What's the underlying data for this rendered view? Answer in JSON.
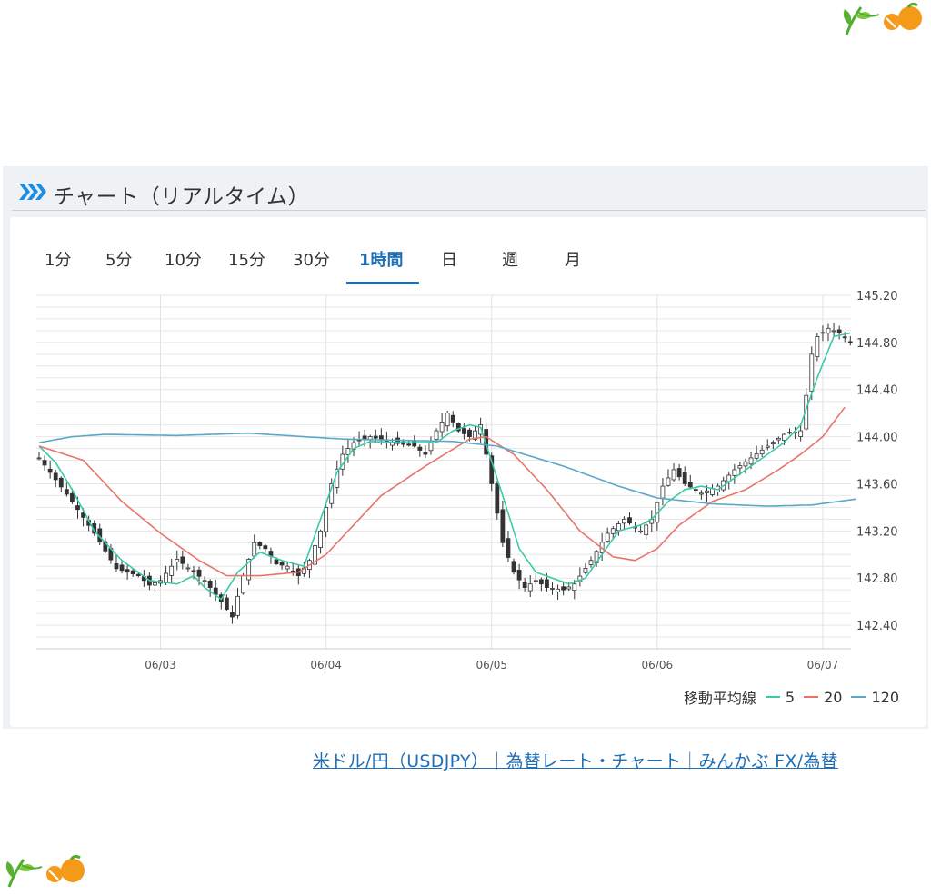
{
  "panel": {
    "title": "チャート（リアルタイム）",
    "tabs": [
      {
        "label": "1分",
        "active": false
      },
      {
        "label": "5分",
        "active": false
      },
      {
        "label": "10分",
        "active": false
      },
      {
        "label": "15分",
        "active": false
      },
      {
        "label": "30分",
        "active": false
      },
      {
        "label": "1時間",
        "active": true
      },
      {
        "label": "日",
        "active": false
      },
      {
        "label": "週",
        "active": false
      },
      {
        "label": "月",
        "active": false
      }
    ],
    "legend": {
      "label": "移動平均線",
      "items": [
        {
          "name": "5",
          "color": "#3cc9a8"
        },
        {
          "name": "20",
          "color": "#e8756b"
        },
        {
          "name": "120",
          "color": "#5aa8c8"
        }
      ]
    }
  },
  "footer_link": "米ドル/円（USDJPY）｜為替レート・チャート｜みんかぶ FX/為替",
  "colors": {
    "accent": "#1e6fb5",
    "candle_up": "#ffffff",
    "candle_down": "#333333"
  },
  "icons": [
    "chevron-right-icon",
    "leaf-orange-icon"
  ],
  "chart_data": {
    "type": "candlestick",
    "x_tick_labels": [
      "06/03",
      "06/04",
      "06/05",
      "06/06",
      "06/07"
    ],
    "y_tick_labels": [
      "142.40",
      "142.80",
      "143.20",
      "143.60",
      "144.00",
      "144.40",
      "144.80",
      "145.20"
    ],
    "ylim": [
      142.2,
      145.2
    ],
    "grid": true,
    "legend_position": "bottom-right",
    "moving_averages": [
      {
        "name": "5",
        "anchors": [
          [
            0,
            143.92
          ],
          [
            3,
            143.78
          ],
          [
            6,
            143.55
          ],
          [
            10,
            143.2
          ],
          [
            15,
            142.95
          ],
          [
            20,
            142.78
          ],
          [
            25,
            142.75
          ],
          [
            28,
            142.82
          ],
          [
            30,
            142.72
          ],
          [
            33,
            142.62
          ],
          [
            36,
            142.85
          ],
          [
            40,
            143.02
          ],
          [
            44,
            142.95
          ],
          [
            48,
            142.9
          ],
          [
            51,
            143.3
          ],
          [
            54,
            143.7
          ],
          [
            57,
            143.9
          ],
          [
            60,
            143.96
          ],
          [
            66,
            143.95
          ],
          [
            72,
            143.95
          ],
          [
            75,
            144.05
          ],
          [
            78,
            144.1
          ],
          [
            80,
            144.08
          ],
          [
            84,
            143.5
          ],
          [
            87,
            143.05
          ],
          [
            90,
            142.85
          ],
          [
            93,
            142.8
          ],
          [
            96,
            142.75
          ],
          [
            99,
            142.8
          ],
          [
            102,
            143.0
          ],
          [
            105,
            143.2
          ],
          [
            109,
            143.25
          ],
          [
            111,
            143.3
          ],
          [
            114,
            143.45
          ],
          [
            117,
            143.55
          ],
          [
            120,
            143.58
          ],
          [
            123,
            143.55
          ],
          [
            126,
            143.65
          ],
          [
            129,
            143.75
          ],
          [
            132,
            143.85
          ],
          [
            135,
            143.95
          ],
          [
            138,
            144.1
          ],
          [
            141,
            144.5
          ],
          [
            144,
            144.85
          ],
          [
            147,
            144.88
          ]
        ]
      },
      {
        "name": "20",
        "anchors": [
          [
            0,
            143.92
          ],
          [
            8,
            143.8
          ],
          [
            15,
            143.45
          ],
          [
            22,
            143.18
          ],
          [
            29,
            142.95
          ],
          [
            34,
            142.82
          ],
          [
            40,
            142.82
          ],
          [
            47,
            142.85
          ],
          [
            52,
            143.0
          ],
          [
            57,
            143.25
          ],
          [
            62,
            143.5
          ],
          [
            70,
            143.75
          ],
          [
            78,
            143.98
          ],
          [
            81,
            144.0
          ],
          [
            86,
            143.85
          ],
          [
            92,
            143.55
          ],
          [
            98,
            143.2
          ],
          [
            104,
            142.98
          ],
          [
            108,
            142.95
          ],
          [
            112,
            143.05
          ],
          [
            116,
            143.25
          ],
          [
            122,
            143.45
          ],
          [
            128,
            143.55
          ],
          [
            134,
            143.72
          ],
          [
            138,
            143.85
          ],
          [
            142,
            144.0
          ],
          [
            146,
            144.25
          ]
        ]
      },
      {
        "name": "120",
        "anchors": [
          [
            0,
            143.95
          ],
          [
            6,
            144.0
          ],
          [
            12,
            144.02
          ],
          [
            25,
            144.01
          ],
          [
            38,
            144.03
          ],
          [
            48,
            144.0
          ],
          [
            55,
            143.98
          ],
          [
            65,
            143.97
          ],
          [
            75,
            143.96
          ],
          [
            83,
            143.92
          ],
          [
            95,
            143.75
          ],
          [
            105,
            143.58
          ],
          [
            112,
            143.48
          ],
          [
            122,
            143.43
          ],
          [
            132,
            143.41
          ],
          [
            140,
            143.42
          ],
          [
            148,
            143.47
          ]
        ]
      }
    ],
    "price_anchors": [
      [
        0,
        143.82
      ],
      [
        6,
        143.45
      ],
      [
        10,
        143.18
      ],
      [
        14,
        142.88
      ],
      [
        18,
        142.82
      ],
      [
        20,
        142.74
      ],
      [
        22,
        142.78
      ],
      [
        25,
        142.96
      ],
      [
        28,
        142.85
      ],
      [
        30,
        142.78
      ],
      [
        33,
        142.6
      ],
      [
        35,
        142.47
      ],
      [
        37,
        142.82
      ],
      [
        39,
        143.1
      ],
      [
        41,
        143.05
      ],
      [
        43,
        142.92
      ],
      [
        45,
        142.9
      ],
      [
        47,
        142.82
      ],
      [
        49,
        142.95
      ],
      [
        51,
        143.2
      ],
      [
        53,
        143.6
      ],
      [
        55,
        143.85
      ],
      [
        57,
        143.95
      ],
      [
        60,
        144.0
      ],
      [
        64,
        143.95
      ],
      [
        68,
        143.92
      ],
      [
        70,
        143.85
      ],
      [
        72,
        144.05
      ],
      [
        74,
        144.2
      ],
      [
        76,
        144.05
      ],
      [
        78,
        144.0
      ],
      [
        80,
        144.1
      ],
      [
        82,
        143.6
      ],
      [
        84,
        143.1
      ],
      [
        86,
        142.85
      ],
      [
        88,
        142.72
      ],
      [
        90,
        142.78
      ],
      [
        92,
        142.72
      ],
      [
        95,
        142.7
      ],
      [
        97,
        142.75
      ],
      [
        100,
        142.95
      ],
      [
        103,
        143.18
      ],
      [
        106,
        143.3
      ],
      [
        109,
        143.2
      ],
      [
        111,
        143.3
      ],
      [
        113,
        143.58
      ],
      [
        115,
        143.72
      ],
      [
        117,
        143.6
      ],
      [
        120,
        143.52
      ],
      [
        123,
        143.58
      ],
      [
        126,
        143.72
      ],
      [
        129,
        143.82
      ],
      [
        132,
        143.92
      ],
      [
        135,
        144.02
      ],
      [
        138,
        144.05
      ],
      [
        139,
        144.35
      ],
      [
        140,
        144.7
      ],
      [
        141,
        144.85
      ],
      [
        143,
        144.92
      ],
      [
        145,
        144.88
      ],
      [
        147,
        144.8
      ]
    ]
  }
}
